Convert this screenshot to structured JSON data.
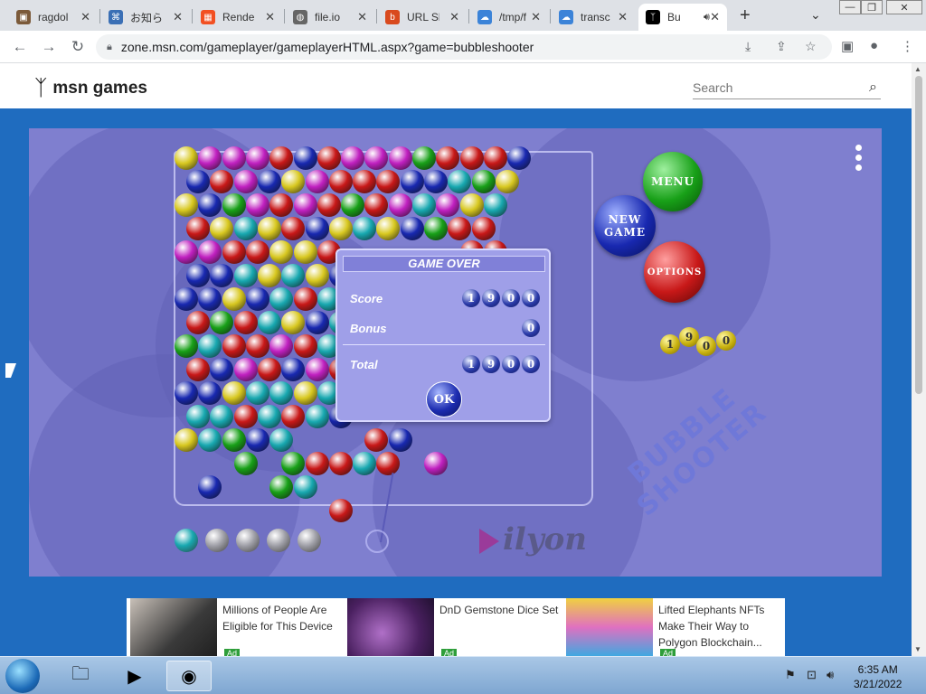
{
  "browser": {
    "tabs": [
      {
        "title": "ragdol",
        "color": "#7b5a3a",
        "glyph": "▣"
      },
      {
        "title": "お知らせ",
        "color": "#3a6fb5",
        "glyph": "⌘"
      },
      {
        "title": "Render",
        "color": "#f25022",
        "glyph": "▦"
      },
      {
        "title": "file.io",
        "color": "#666666",
        "glyph": "◍"
      },
      {
        "title": "URL Sh",
        "color": "#d94a1e",
        "glyph": "b"
      },
      {
        "title": "/tmp/f",
        "color": "#3b83d8",
        "glyph": "☁"
      },
      {
        "title": "transc",
        "color": "#3b83d8",
        "glyph": "☁"
      },
      {
        "title": "Bu",
        "color": "#000000",
        "glyph": "ᛉ"
      }
    ],
    "close_glyph": "✕",
    "new_tab_glyph": "+",
    "tab_menu_glyph": "⌄",
    "window_controls": {
      "minimize": "—",
      "maximize": "❐",
      "close": "✕"
    },
    "nav": {
      "back": "←",
      "forward": "→",
      "reload": "↻"
    },
    "url": "zone.msn.com/gameplayer/gameplayerHTML.aspx?game=bubbleshooter",
    "omnibox_icons": {
      "install": "⤓",
      "share": "⇪",
      "bookmark": "☆"
    },
    "right_icons": {
      "sidebar": "▣",
      "profile": "●",
      "menu": "⋮"
    }
  },
  "header": {
    "logo_text": "msn games",
    "search_placeholder": "Search",
    "search_icon": "⌕"
  },
  "game": {
    "menu_button": "MENU",
    "new_game_button": "NEW\nGAME",
    "options_button": "OPTIONS",
    "score_digits": [
      "1",
      "9",
      "0",
      "0"
    ],
    "title_line1": "BUBBLE",
    "title_line2": "SHOOTER",
    "brand": "ilyon",
    "dialog": {
      "title": "GAME OVER",
      "score_label": "Score",
      "score_digits": [
        "1",
        "9",
        "0",
        "0"
      ],
      "bonus_label": "Bonus",
      "bonus_digits": [
        "0"
      ],
      "total_label": "Total",
      "total_digits": [
        "1",
        "9",
        "0",
        "0"
      ],
      "ok_label": "OK"
    },
    "colors": {
      "yellow": "#d8c820",
      "magenta": "#c020c0",
      "red": "#c81818",
      "blue": "#1828b0",
      "green": "#18a018",
      "cyan": "#18a8b0",
      "gray": "#a0a0a8"
    }
  },
  "ads": [
    {
      "text": "Millions of People Are Eligible for This Device",
      "tag": "Ad"
    },
    {
      "text": "DnD Gemstone Dice Set",
      "tag": "Ad"
    },
    {
      "text": "Lifted Elephants NFTs Make Their Way to Polygon Blockchain...",
      "tag": "Ad"
    }
  ],
  "taskbar": {
    "time": "6:35 AM",
    "date": "3/21/2022"
  }
}
